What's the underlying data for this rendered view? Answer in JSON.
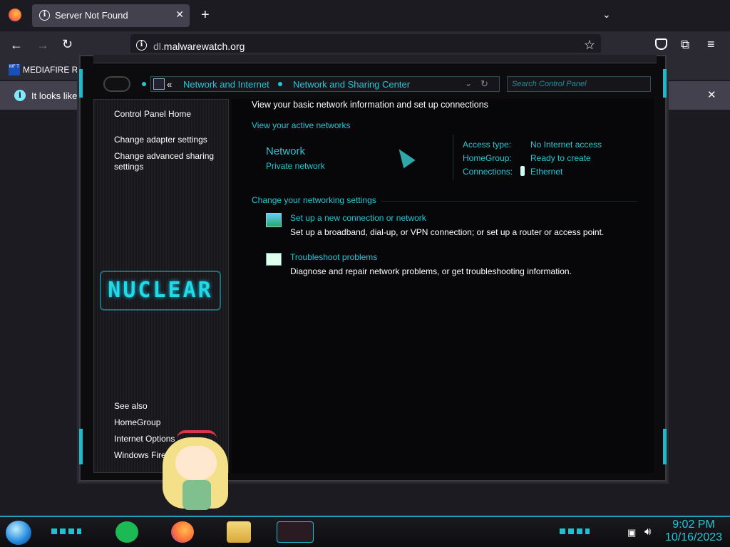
{
  "browser": {
    "tab_title": "Server Not Found",
    "url_main": "dl.",
    "url_domain": "malwarewatch.org",
    "bookmark_label": "MEDIAFIRE RO",
    "info_bar_text": "It looks like y"
  },
  "control_panel": {
    "breadcrumb_root": "«",
    "breadcrumb_1": "Network and Internet",
    "breadcrumb_2": "Network and Sharing Center",
    "search_placeholder": "Search Control Panel",
    "sidebar": {
      "home": "Control Panel Home",
      "adapter": "Change adapter settings",
      "advanced_1": "Change advanced sharing",
      "advanced_2": "settings",
      "see_also": "See also",
      "homegroup": "HomeGroup",
      "internet_options": "Internet Options",
      "windows_firewall": "Windows Firev"
    },
    "logo_text": "NUCLEAR",
    "heading": "View your basic network information and set up connections",
    "active_networks": "View your active networks",
    "network_name": "Network",
    "network_type": "Private network",
    "access_type_label": "Access type:",
    "access_type_value": "No Internet access",
    "homegroup_label": "HomeGroup:",
    "homegroup_value": "Ready to create",
    "connections_label": "Connections:",
    "connections_value": "Ethernet",
    "change_settings": "Change your networking settings",
    "setup_title": "Set up a new connection or network",
    "setup_desc": "Set up a broadband, dial-up, or VPN connection; or set up a router or access point.",
    "troubleshoot_title": "Troubleshoot problems",
    "troubleshoot_desc": "Diagnose and repair network problems, or get troubleshooting information."
  },
  "taskbar": {
    "time": "9:02 PM",
    "date": "10/16/2023"
  },
  "icons": [
    "firefox-icon",
    "info-icon",
    "close-icon",
    "plus-icon",
    "chevron-down-icon",
    "back-icon",
    "forward-icon",
    "reload-icon",
    "star-icon",
    "pocket-icon",
    "extensions-icon",
    "menu-icon",
    "network-icon",
    "refresh-icon",
    "start-orb-icon",
    "spotify-icon",
    "explorer-icon",
    "speaker-icon"
  ]
}
